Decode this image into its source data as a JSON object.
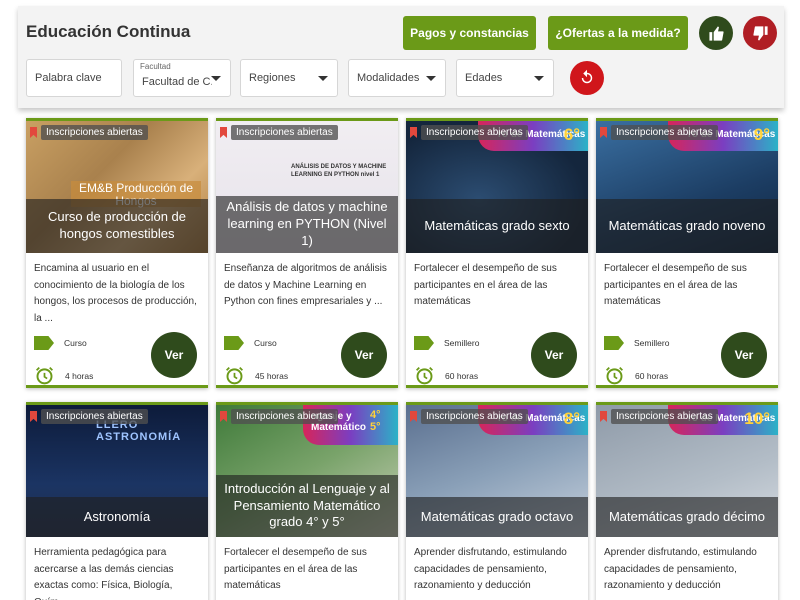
{
  "header": {
    "title": "Educación Continua",
    "pagos_label": "Pagos y constancias",
    "ofertas_label": "¿Ofertas a la medida?"
  },
  "filters": {
    "keyword_placeholder": "Palabra clave",
    "facultad_label": "Facultad",
    "facultad_value": "Facultad de C...",
    "regiones": "Regiones",
    "modalidades": "Modalidades",
    "edades": "Edades"
  },
  "colors": {
    "accent": "#6b9a18",
    "ver": "#2f4b1c",
    "dislike": "#b01e24",
    "like": "#2f4b1c",
    "reset": "#d0161b"
  },
  "cards": [
    {
      "badge": "Inscripciones abiertas",
      "title": "Curso de producción de hongos comestibles",
      "image_text": "EM&B Producción de Hongos",
      "description": "Encamina al usuario en el conocimiento de la biología de los hongos, los procesos de producción, la ...",
      "type": "Curso",
      "duration": "4 horas",
      "button": "Ver"
    },
    {
      "badge": "Inscripciones abiertas",
      "title": "Análisis de datos y machine learning en PYTHON (Nivel 1)",
      "image_text": "ANÁLISIS DE DATOS Y MACHINE LEARNING EN PYTHON nivel 1",
      "description": "Enseñanza de algoritmos de análisis de datos y Machine Learning en Python con fines empresariales y ...",
      "type": "Curso",
      "duration": "45 horas",
      "button": "Ver"
    },
    {
      "badge": "Inscripciones abiertas",
      "title": "Matemáticas grado sexto",
      "banner_text": "ro de Matemáticas",
      "banner_number": "6°",
      "description": "Fortalecer el desempeño de sus participantes en el área de las matemáticas",
      "type": "Semillero",
      "duration": "60 horas",
      "button": "Ver"
    },
    {
      "badge": "Inscripciones abiertas",
      "title": "Matemáticas grado noveno",
      "banner_text": "ro de Matemáticas",
      "banner_number": "9°",
      "description": "Fortalecer el desempeño de sus participantes en el área de las matemáticas",
      "type": "Semillero",
      "duration": "60 horas",
      "button": "Ver"
    },
    {
      "badge": "Inscripciones abiertas",
      "title": "Astronomía",
      "image_text": "LLERO ASTRONOMÍA",
      "description": "Herramienta pedagógica para acercarse a las demás ciencias exactas como: Física, Biología, Quím..."
    },
    {
      "badge": "Inscripciones abiertas",
      "title": "Introducción al Lenguaje y al Pensamiento Matemático grado 4° y 5°",
      "banner_text": "nguaje y Matemático",
      "banner_number": "4° 5°",
      "description": "Fortalecer el desempeño de sus participantes en el área de las matemáticas"
    },
    {
      "badge": "Inscripciones abiertas",
      "title": "Matemáticas grado octavo",
      "banner_text": "ro de Matemáticas",
      "banner_number": "8°",
      "description": "Aprender disfrutando, estimulando capacidades de pensamiento, razonamiento y deducción"
    },
    {
      "badge": "Inscripciones abiertas",
      "title": "Matemáticas grado décimo",
      "banner_text": "ro de Matemáticas",
      "banner_number": "10°",
      "description": "Aprender disfrutando, estimulando capacidades de pensamiento, razonamiento y deducción"
    }
  ]
}
